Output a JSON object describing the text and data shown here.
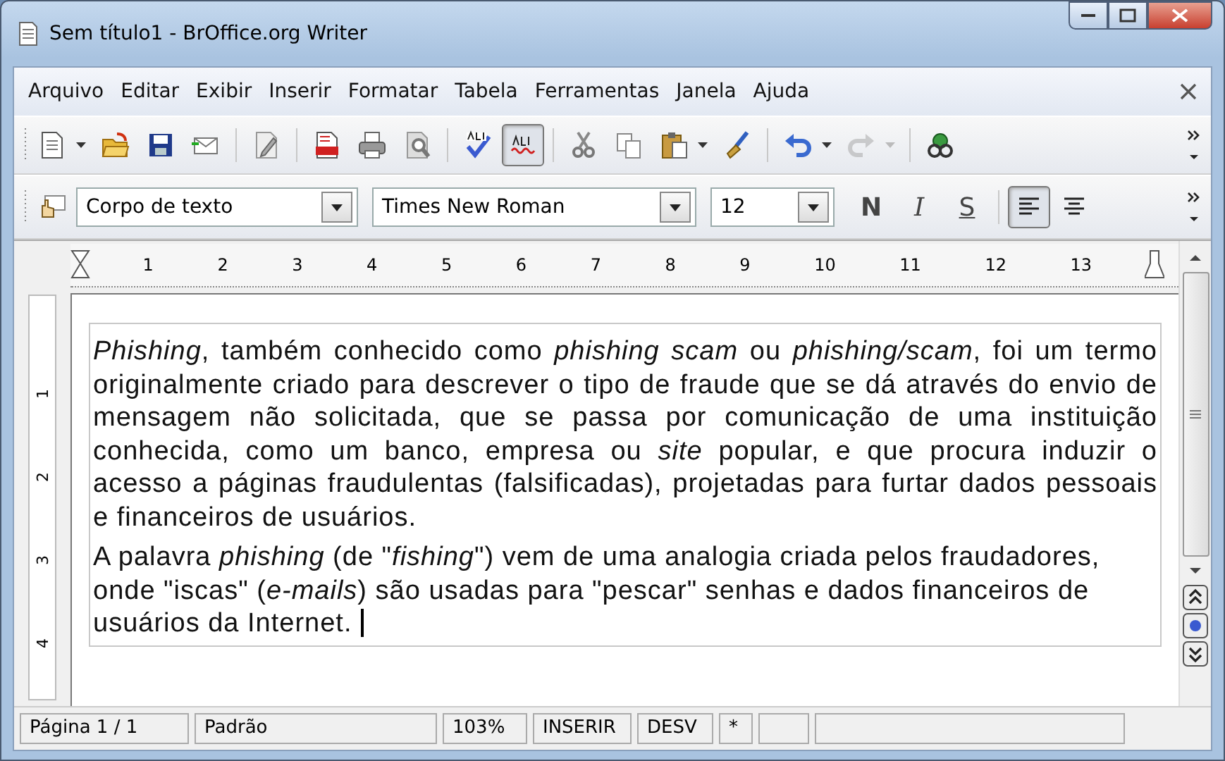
{
  "window": {
    "title": "Sem título1 - BrOffice.org Writer"
  },
  "menu": [
    "Arquivo",
    "Editar",
    "Exibir",
    "Inserir",
    "Formatar",
    "Tabela",
    "Ferramentas",
    "Janela",
    "Ajuda"
  ],
  "standard_toolbar": [
    {
      "kind": "new",
      "menu": true
    },
    {
      "kind": "open"
    },
    {
      "kind": "save"
    },
    {
      "kind": "email"
    },
    {
      "kind": "sep"
    },
    {
      "kind": "edit"
    },
    {
      "kind": "sep"
    },
    {
      "kind": "pdf"
    },
    {
      "kind": "print"
    },
    {
      "kind": "preview"
    },
    {
      "kind": "sep"
    },
    {
      "kind": "spell"
    },
    {
      "kind": "autospell",
      "pressed": true
    },
    {
      "kind": "sep"
    },
    {
      "kind": "cut"
    },
    {
      "kind": "copy"
    },
    {
      "kind": "paste",
      "menu": true
    },
    {
      "kind": "brush"
    },
    {
      "kind": "sep"
    },
    {
      "kind": "undo",
      "menu": true
    },
    {
      "kind": "redo",
      "menu": true,
      "disabled": true
    },
    {
      "kind": "sep"
    },
    {
      "kind": "navigator"
    }
  ],
  "format_toolbar": {
    "style": "Corpo de texto",
    "font": "Times New Roman",
    "size": "12",
    "buttons": [
      {
        "kind": "bold",
        "label": "N"
      },
      {
        "kind": "italic",
        "label": "I"
      },
      {
        "kind": "underline",
        "label": "S"
      }
    ],
    "alignment": [
      {
        "kind": "left",
        "selected": true
      },
      {
        "kind": "center",
        "selected": false
      }
    ]
  },
  "ruler": [
    "1",
    "2",
    "3",
    "4",
    "5",
    "6",
    "7",
    "8",
    "9",
    "10",
    "11",
    "12",
    "13"
  ],
  "vertical_ruler": [
    "1",
    "2",
    "3",
    "4"
  ],
  "paragraphs": [
    {
      "text": "*Phishing*, também conhecido como *phishing scam* ou *phishing/scam*, foi um termo originalmente criado para descrever o tipo de fraude que se dá através do envio de mensagem não solicitada, que se passa por comunicação de uma instituição conhecida, como um banco, empresa ou *site* popular, e que procura induzir o acesso a páginas fraudulentas (falsificadas), projetadas para furtar dados pessoais e financeiros de usuários.",
      "justified": true,
      "cursor": false
    },
    {
      "text": "A palavra *phishing* (de \"*fishing*\") vem de uma analogia criada pelos fraudadores, onde \"iscas\" (*e-mails*) são usadas para \"pescar\" senhas e dados financeiros de usuários da Internet.",
      "justified": false,
      "cursor": true
    }
  ],
  "status_bar": [
    "Página 1 / 1",
    "Padrão",
    "103%",
    "INSERIR",
    "DESV",
    "*"
  ]
}
